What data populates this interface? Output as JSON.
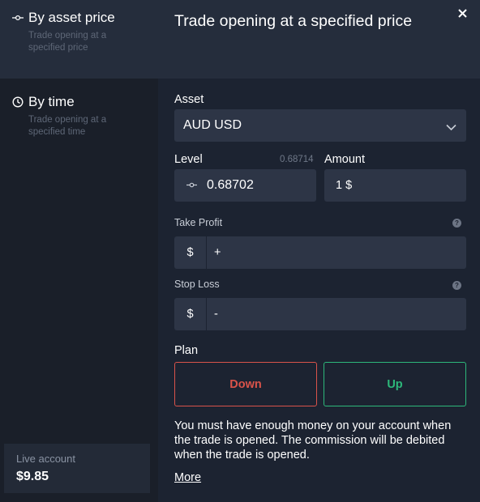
{
  "sidebar": {
    "items": [
      {
        "label": "By asset price",
        "description": "Trade opening at a specified price",
        "icon": "price-level-icon",
        "active": true
      },
      {
        "label": "By time",
        "description": "Trade opening at a specified time",
        "icon": "clock-icon",
        "active": false
      }
    ],
    "account": {
      "label": "Live account",
      "balance": "$9.85"
    }
  },
  "main": {
    "title": "Trade opening at a specified price",
    "asset": {
      "label": "Asset",
      "value": "AUD USD"
    },
    "level": {
      "label": "Level",
      "hint": "0.68714",
      "value": "0.68702"
    },
    "amount": {
      "label": "Amount",
      "value": "1 $"
    },
    "take_profit": {
      "label": "Take Profit",
      "currency": "$",
      "placeholder": "+"
    },
    "stop_loss": {
      "label": "Stop Loss",
      "currency": "$",
      "placeholder": "-"
    },
    "plan": {
      "label": "Plan",
      "down_label": "Down",
      "up_label": "Up"
    },
    "notice": "You must have enough money on your account when the trade is opened. The commission will be debited when the trade is opened.",
    "more_label": "More",
    "help_glyph": "?"
  },
  "colors": {
    "background": "#1c2331",
    "sidebar": "#1a1f29",
    "active_panel": "#252d3c",
    "field": "#2d3546",
    "down": "#d9534a",
    "up": "#2db87a"
  }
}
